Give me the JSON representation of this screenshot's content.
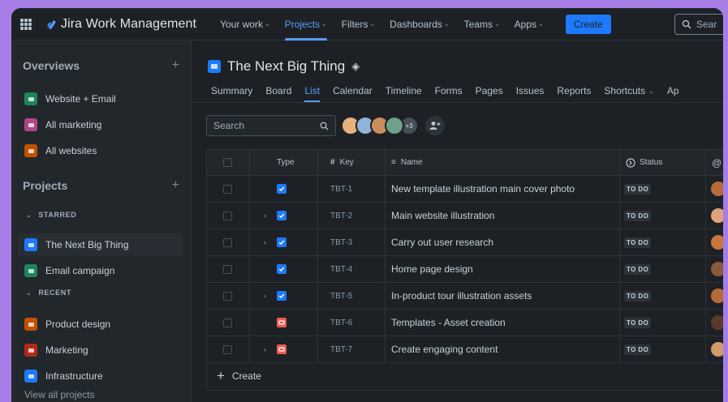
{
  "topnav": {
    "brand": "Jira Work Management",
    "items": [
      {
        "label": "Your work",
        "active": false
      },
      {
        "label": "Projects",
        "active": true
      },
      {
        "label": "Filters",
        "active": false
      },
      {
        "label": "Dashboards",
        "active": false
      },
      {
        "label": "Teams",
        "active": false
      },
      {
        "label": "Apps",
        "active": false
      }
    ],
    "create_label": "Create",
    "search_placeholder": "Sear"
  },
  "sidebar": {
    "overviews_title": "Overviews",
    "overviews": [
      {
        "label": "Website + Email",
        "color": "#1f845a"
      },
      {
        "label": "All marketing",
        "color": "#ae4787"
      },
      {
        "label": "All websites",
        "color": "#c25100"
      }
    ],
    "projects_title": "Projects",
    "starred_label": "STARRED",
    "starred": [
      {
        "label": "The Next Big Thing",
        "color": "#1d7afc"
      },
      {
        "label": "Email campaign",
        "color": "#1f845a"
      }
    ],
    "recent_label": "RECENT",
    "recent": [
      {
        "label": "Product design",
        "color": "#c25100"
      },
      {
        "label": "Marketing",
        "color": "#ae2a19"
      },
      {
        "label": "Infrastructure",
        "color": "#1d7afc"
      }
    ],
    "footer": "View all projects"
  },
  "project": {
    "title": "The Next Big Thing",
    "tabs": [
      "Summary",
      "Board",
      "List",
      "Calendar",
      "Timeline",
      "Forms",
      "Pages",
      "Issues",
      "Reports",
      "Shortcuts",
      "Ap"
    ],
    "active_tab": "List",
    "shortcuts_has_dropdown": true
  },
  "filter": {
    "search_placeholder": "Search",
    "more_count": "+3"
  },
  "table": {
    "headers": {
      "type": "Type",
      "key": "Key",
      "name": "Name",
      "status": "Status"
    },
    "rows": [
      {
        "expand": false,
        "type": "story",
        "key": "TBT-1",
        "name": "New template illustration main cover photo",
        "status": "TO DO",
        "avatar": "#b86b3a"
      },
      {
        "expand": true,
        "type": "story",
        "key": "TBT-2",
        "name": "Main website illustration",
        "status": "TO DO",
        "avatar": "#e0a37a"
      },
      {
        "expand": true,
        "type": "story",
        "key": "TBT-3",
        "name": "Carry out user research",
        "status": "TO DO",
        "avatar": "#c7763f"
      },
      {
        "expand": false,
        "type": "story",
        "key": "TBT-4",
        "name": "Home page design",
        "status": "TO DO",
        "avatar": "#8a5a3a"
      },
      {
        "expand": true,
        "type": "story",
        "key": "TBT-5",
        "name": "In-product tour illustration assets",
        "status": "TO DO",
        "avatar": "#b86b3a"
      },
      {
        "expand": false,
        "type": "bug",
        "key": "TBT-6",
        "name": "Templates - Asset creation",
        "status": "TO DO",
        "avatar": "#5a3a2a"
      },
      {
        "expand": true,
        "type": "bug",
        "key": "TBT-7",
        "name": "Create engaging content",
        "status": "TO DO",
        "avatar": "#d39a6a"
      }
    ],
    "create_label": "Create"
  }
}
